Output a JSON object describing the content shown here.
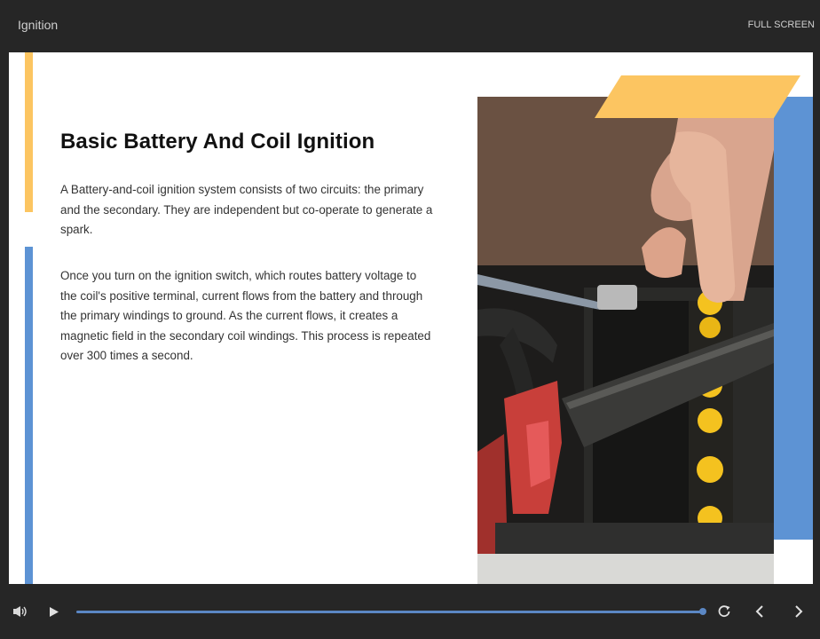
{
  "window": {
    "title": "Ignition",
    "fullscreen_label": "FULL SCREEN"
  },
  "slide": {
    "title": "Basic Battery And Coil Ignition",
    "paragraphs": [
      "A Battery-and-coil ignition system consists of two circuits: the primary and the secondary. They are independent but co-operate to generate a spark.",
      "Once you turn on the ignition switch, which routes battery voltage to the coil's positive terminal, current flows from the battery and through the primary windings to ground. As the current flows, it creates a magnetic field in the secondary coil windings. This process is repeated over 300 times a second."
    ],
    "image": {
      "subject": "battery-photo"
    }
  },
  "player": {
    "progress": 1.0,
    "icons": [
      "volume-icon",
      "play-icon",
      "replay-icon",
      "previous-icon",
      "next-icon"
    ]
  },
  "colors": {
    "accent_yellow": "#fcc561",
    "accent_blue": "#5d93d4",
    "progress": "#5b87c4",
    "chrome_bg": "#262626"
  }
}
